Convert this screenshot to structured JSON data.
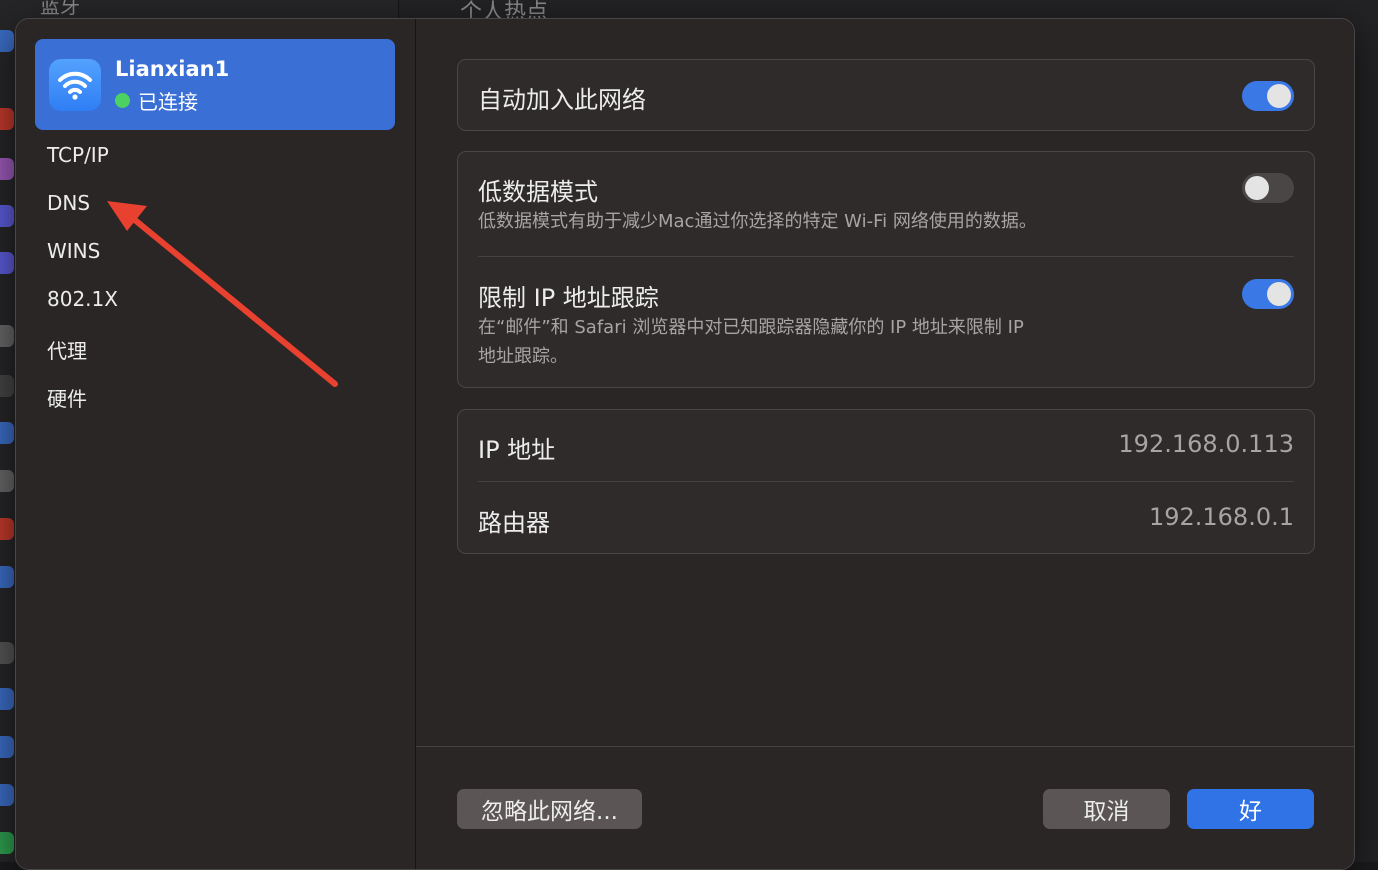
{
  "background": {
    "sidebar_label": "蓝牙",
    "title": "个人热点"
  },
  "network": {
    "name": "Lianxian1",
    "status": "已连接",
    "icon": "wifi-icon"
  },
  "sidebar": {
    "items": [
      {
        "label": "TCP/IP"
      },
      {
        "label": "DNS"
      },
      {
        "label": "WINS"
      },
      {
        "label": "802.1X"
      },
      {
        "label": "代理"
      },
      {
        "label": "硬件"
      }
    ]
  },
  "settings": {
    "auto_join": {
      "title": "自动加入此网络",
      "on": true
    },
    "low_data": {
      "title": "低数据模式",
      "description": "低数据模式有助于减少Mac通过你选择的特定 Wi-Fi 网络使用的数据。",
      "on": false
    },
    "limit_ip": {
      "title": "限制 IP 地址跟踪",
      "description_line1": "在“邮件”和 Safari 浏览器中对已知跟踪器隐藏你的 IP 地址来限制 IP",
      "description_line2": "地址跟踪。",
      "on": true
    }
  },
  "info": {
    "ip_label": "IP 地址",
    "ip_value": "192.168.0.113",
    "router_label": "路由器",
    "router_value": "192.168.0.1"
  },
  "footer": {
    "forget_label": "忽略此网络...",
    "cancel_label": "取消",
    "ok_label": "好"
  },
  "colors": {
    "accent": "#3a78e6",
    "selected": "#3a6fd6",
    "status_green": "#4bd263",
    "annotation_arrow": "#e8412f"
  }
}
